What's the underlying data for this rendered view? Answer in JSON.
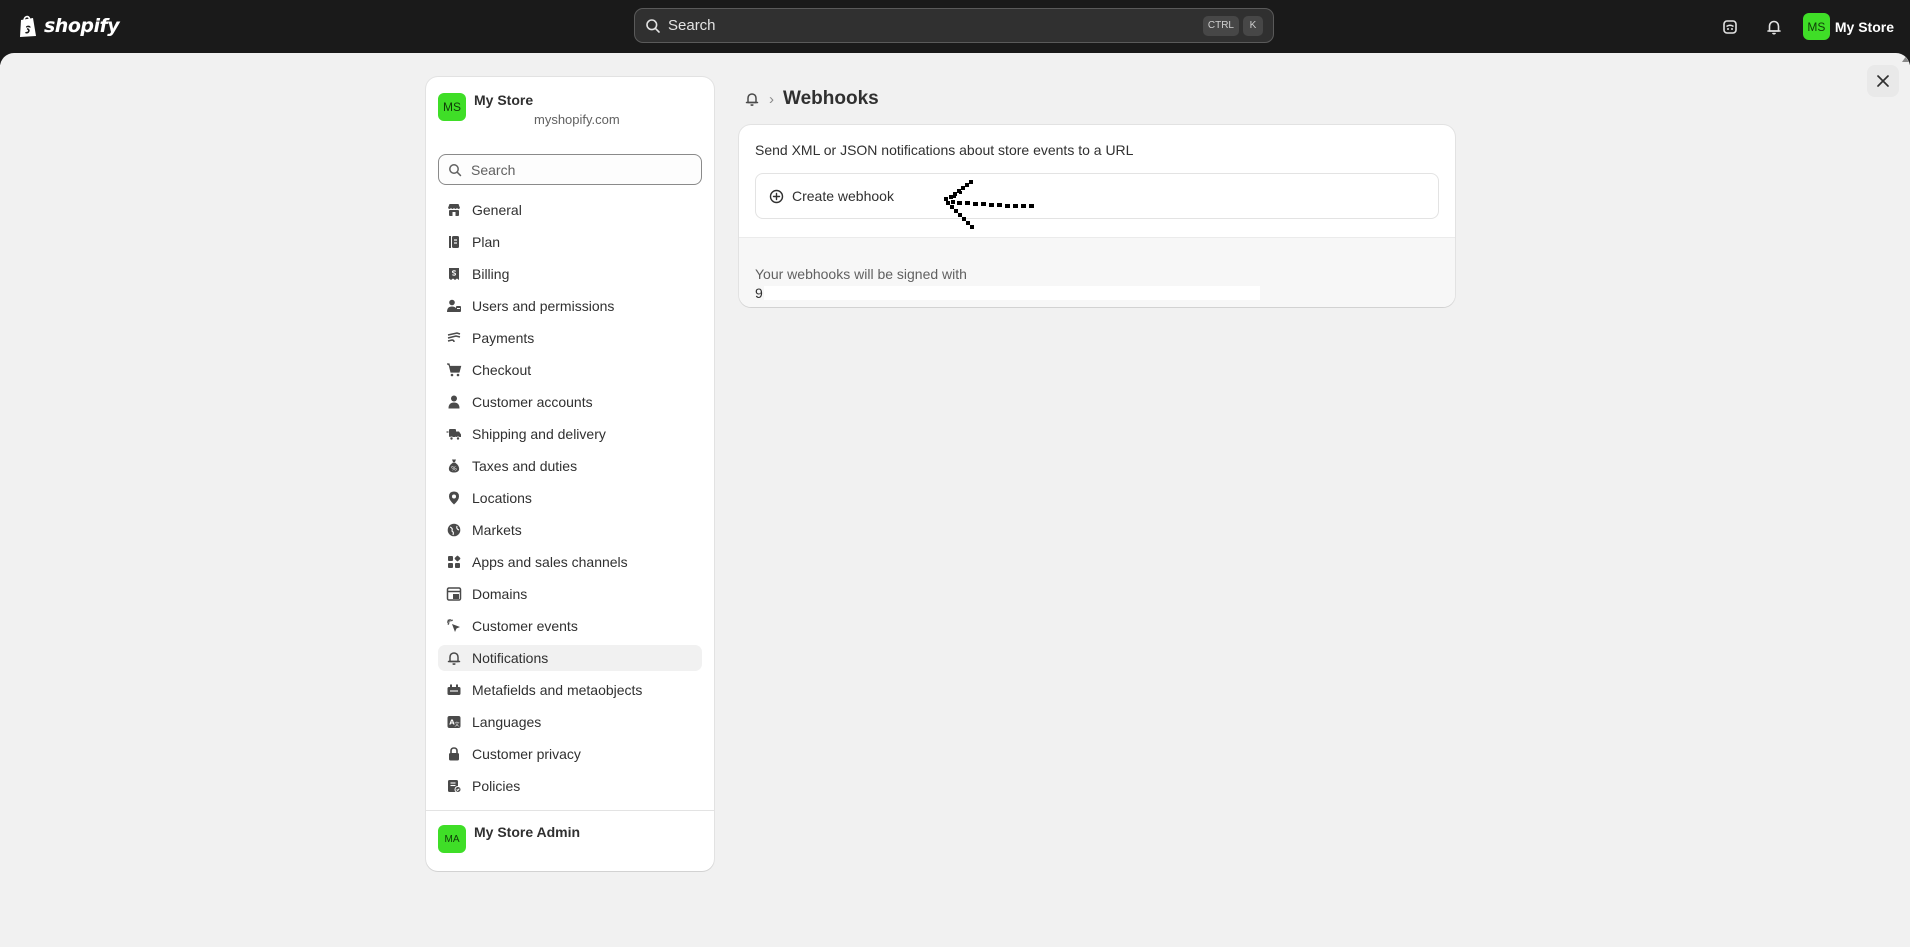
{
  "topbar": {
    "logo_text": "shopify",
    "search_placeholder": "Search",
    "shortcut_keys": [
      "CTRL",
      "K"
    ],
    "store_initials": "MS",
    "store_name": "My Store"
  },
  "sidebar": {
    "store_initials": "MS",
    "store_name": "My Store",
    "store_domain_suffix": "myshopify.com",
    "search_placeholder": "Search",
    "items": [
      {
        "label": "General",
        "icon": "store-icon"
      },
      {
        "label": "Plan",
        "icon": "plan-icon"
      },
      {
        "label": "Billing",
        "icon": "receipt-icon"
      },
      {
        "label": "Users and permissions",
        "icon": "users-icon"
      },
      {
        "label": "Payments",
        "icon": "payment-icon"
      },
      {
        "label": "Checkout",
        "icon": "cart-icon"
      },
      {
        "label": "Customer accounts",
        "icon": "person-icon"
      },
      {
        "label": "Shipping and delivery",
        "icon": "truck-icon"
      },
      {
        "label": "Taxes and duties",
        "icon": "tax-icon"
      },
      {
        "label": "Locations",
        "icon": "location-icon"
      },
      {
        "label": "Markets",
        "icon": "globe-icon"
      },
      {
        "label": "Apps and sales channels",
        "icon": "apps-icon"
      },
      {
        "label": "Domains",
        "icon": "domain-icon"
      },
      {
        "label": "Customer events",
        "icon": "cursor-icon"
      },
      {
        "label": "Notifications",
        "icon": "bell-icon",
        "active": true
      },
      {
        "label": "Metafields and metaobjects",
        "icon": "metafields-icon"
      },
      {
        "label": "Languages",
        "icon": "language-icon"
      },
      {
        "label": "Customer privacy",
        "icon": "lock-icon"
      },
      {
        "label": "Policies",
        "icon": "policy-icon"
      }
    ],
    "admin_initials": "MA",
    "admin_name": "My Store Admin"
  },
  "content": {
    "breadcrumb_separator": "›",
    "page_title": "Webhooks",
    "description": "Send XML or JSON notifications about store events to a URL",
    "create_button_label": "Create webhook",
    "signed_label": "Your webhooks will be signed with",
    "signed_key_prefix": "9"
  },
  "colors": {
    "topbar": "#1a1a1a",
    "avatar_green": "#3fde27",
    "background": "#f1f1f1"
  }
}
